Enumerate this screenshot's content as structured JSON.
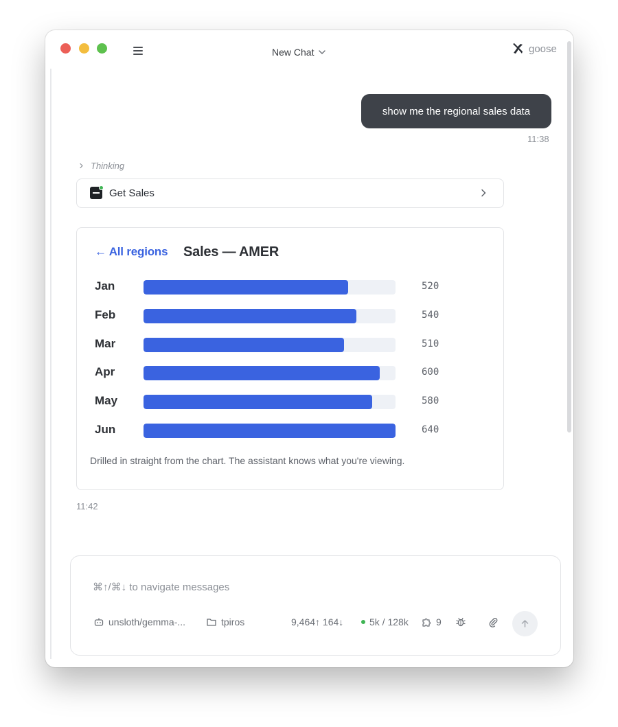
{
  "header": {
    "title": "New Chat",
    "brand": "goose"
  },
  "conversation": {
    "user_message": "show me the regional sales data",
    "user_time": "11:38",
    "thinking_label": "Thinking",
    "tool_call": "Get Sales",
    "assistant_time": "11:42"
  },
  "chart_data": {
    "type": "bar",
    "title": "Sales — AMER",
    "back_label": "← All regions",
    "categories": [
      "Jan",
      "Feb",
      "Mar",
      "Apr",
      "May",
      "Jun"
    ],
    "values": [
      520,
      540,
      510,
      600,
      580,
      640
    ],
    "xlim": [
      0,
      640
    ],
    "bar_color": "#3a63e0",
    "track_color": "#eef1f6",
    "note": "Drilled in straight from the chart. The assistant knows what you're viewing."
  },
  "composer": {
    "placeholder": "⌘↑/⌘↓ to navigate messages",
    "model": "unsloth/gemma-...",
    "folder": "tpiros",
    "tokens": "9,464↑ 164↓",
    "context": "5k / 128k",
    "extensions_count": "9"
  }
}
